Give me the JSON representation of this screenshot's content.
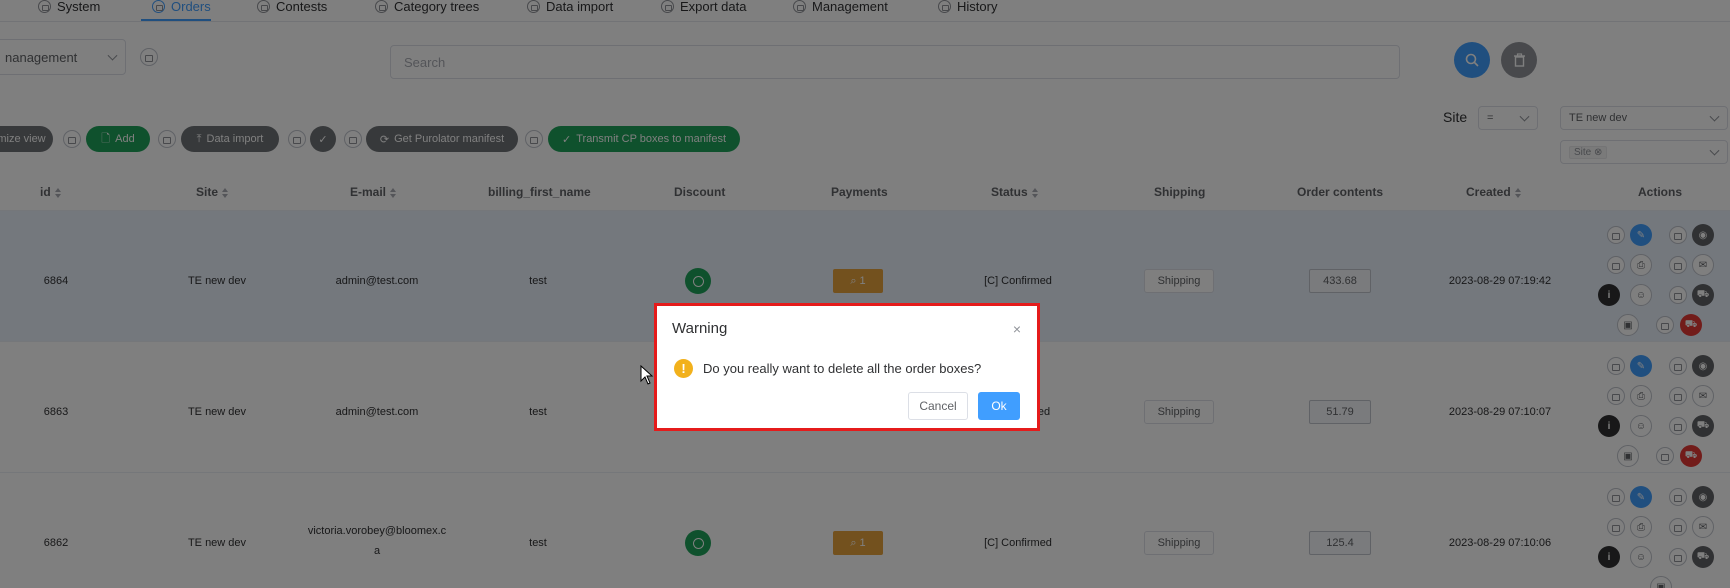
{
  "nav": {
    "tabs": [
      {
        "label": "System"
      },
      {
        "label": "Orders"
      },
      {
        "label": "Contests"
      },
      {
        "label": "Category trees"
      },
      {
        "label": "Data import"
      },
      {
        "label": "Export data"
      },
      {
        "label": "Management"
      },
      {
        "label": "History"
      }
    ]
  },
  "filters": {
    "module_select": "nanagement",
    "search_placeholder": "Search",
    "site_label": "Site",
    "operator": "=",
    "site_value": "TE new dev",
    "site_tag": "Site"
  },
  "toolbar": {
    "customize_view": "mize view",
    "add": "Add",
    "data_import": "Data import",
    "get_purolator": "Get Purolator manifest",
    "transmit_cp": "Transmit CP boxes to manifest"
  },
  "table": {
    "columns": [
      "id",
      "Site",
      "E-mail",
      "billing_first_name",
      "Discount",
      "Payments",
      "Status",
      "Shipping",
      "Order contents",
      "Created",
      "Actions"
    ],
    "rows": [
      {
        "id": "6864",
        "site": "TE new dev",
        "email": "admin@test.com",
        "email2": "",
        "first_name": "test",
        "discount": true,
        "payments": "1",
        "status": "[C] Confirmed",
        "shipping": "Shipping",
        "amount": "433.68",
        "created": "2023-08-29 07:19:42"
      },
      {
        "id": "6863",
        "site": "TE new dev",
        "email": "admin@test.com",
        "email2": "",
        "first_name": "test",
        "discount": false,
        "payments": "",
        "status": "ed",
        "shipping": "Shipping",
        "amount": "51.79",
        "created": "2023-08-29 07:10:07"
      },
      {
        "id": "6862",
        "site": "TE new dev",
        "email": "victoria.vorobey@bloomex.c",
        "email2": "a",
        "first_name": "test",
        "discount": true,
        "payments": "1",
        "status": "[C] Confirmed",
        "shipping": "Shipping",
        "amount": "125.4",
        "created": "2023-08-29 07:10:06"
      }
    ]
  },
  "dialog": {
    "title": "Warning",
    "close": "×",
    "message": "Do you really want to delete all the order boxes?",
    "cancel": "Cancel",
    "ok": "Ok"
  },
  "colors": {
    "primary": "#409eff",
    "success": "#1fa25a",
    "warning": "#e6a23c",
    "danger": "#e53935",
    "highlight_border": "#e51b1b"
  }
}
